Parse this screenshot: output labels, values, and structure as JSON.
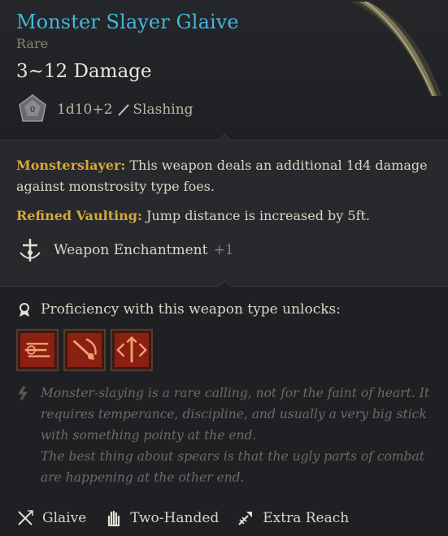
{
  "item": {
    "name": "Monster Slayer Glaive",
    "rarity": "Rare",
    "damage": "3~12 Damage",
    "dice": "1d10+2",
    "damage_type": "Slashing"
  },
  "effects": [
    {
      "name": "Monsterslayer:",
      "text": " This weapon deals an additional 1d4 damage against monstrosity type foes."
    },
    {
      "name": "Refined Vaulting:",
      "text": " Jump distance is increased by 5ft."
    }
  ],
  "enchantment": {
    "label": "Weapon Enchantment",
    "bonus": "+1"
  },
  "proficiency": {
    "heading": "Proficiency with this weapon type unlocks:",
    "actions": [
      {
        "icon": "lacerate-icon"
      },
      {
        "icon": "pommel-strike-icon"
      },
      {
        "icon": "brace-icon"
      }
    ]
  },
  "flavor": [
    "Monster-slaying is a rare calling, not for the faint of heart. It requires temperance, discipline, and usually a very big stick with something pointy at the end.",
    "The best thing about spears is that the ugly parts of combat are happening at the other end."
  ],
  "properties": [
    {
      "icon": "glaive-icon",
      "label": "Glaive"
    },
    {
      "icon": "two-handed-icon",
      "label": "Two-Handed"
    },
    {
      "icon": "extra-reach-icon",
      "label": "Extra Reach"
    }
  ],
  "colors": {
    "name": "#44b6dc",
    "effect_name": "#d8a838",
    "flavor": "#6f6a62",
    "bonus": "#8b8272"
  }
}
